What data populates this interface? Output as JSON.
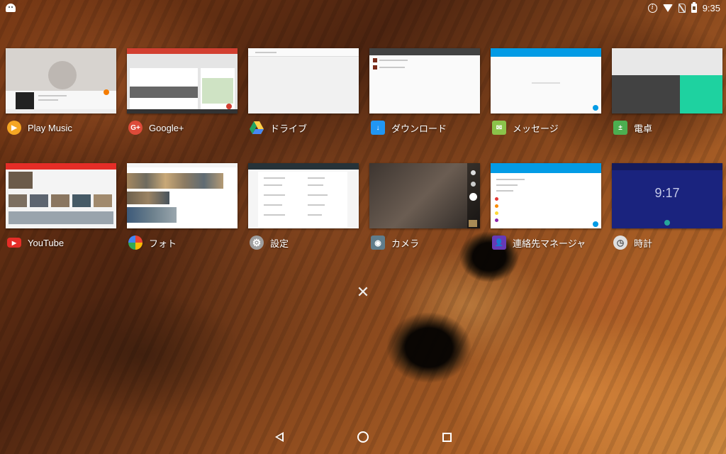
{
  "status_bar": {
    "time": "9:35",
    "icons": [
      "android-icon",
      "info-icon",
      "wifi-icon",
      "no-sim-icon",
      "battery-icon"
    ]
  },
  "recents": {
    "row1": [
      {
        "label": "Play Music",
        "icon": "play-music-icon",
        "icon_color": "#f5a623"
      },
      {
        "label": "Google+",
        "icon": "google-plus-icon",
        "icon_color": "#dd4b39"
      },
      {
        "label": "ドライブ",
        "icon": "drive-icon",
        "icon_color": "#1fa463"
      },
      {
        "label": "ダウンロード",
        "icon": "download-icon",
        "icon_color": "#2196f3"
      },
      {
        "label": "メッセージ",
        "icon": "messages-icon",
        "icon_color": "#8bc34a"
      },
      {
        "label": "電卓",
        "icon": "calculator-icon",
        "icon_color": "#4caf50"
      }
    ],
    "row2": [
      {
        "label": "YouTube",
        "icon": "youtube-icon",
        "icon_color": "#e52d27"
      },
      {
        "label": "フォト",
        "icon": "photos-icon",
        "icon_color": "#fbbc05"
      },
      {
        "label": "設定",
        "icon": "settings-icon",
        "icon_color": "#9e9e9e"
      },
      {
        "label": "カメラ",
        "icon": "camera-icon",
        "icon_color": "#607d8b"
      },
      {
        "label": "連絡先マネージャ",
        "icon": "contacts-icon",
        "icon_color": "#673ab7"
      },
      {
        "label": "時計",
        "icon": "clock-icon",
        "icon_color": "#e0e0e0"
      }
    ],
    "clock_thumb_time": "9:17"
  },
  "nav": {
    "back": "back-icon",
    "home": "home-icon",
    "recents": "recents-icon"
  }
}
